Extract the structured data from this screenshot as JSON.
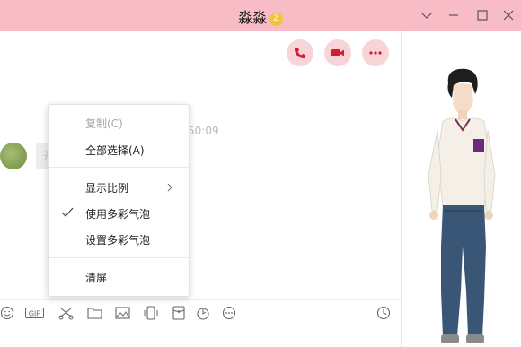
{
  "window": {
    "title": "淼淼",
    "vip_badge": "Z"
  },
  "chat": {
    "timestamp": ":50:09",
    "bubble_text": "开会开会了"
  },
  "menu": {
    "items": [
      {
        "label": "复制(C)",
        "enabled": false
      },
      {
        "label": "全部选择(A)",
        "enabled": true
      },
      {
        "label": "显示比例",
        "enabled": true,
        "submenu": true
      },
      {
        "label": "使用多彩气泡",
        "enabled": true,
        "checked": true
      },
      {
        "label": "设置多彩气泡",
        "enabled": true
      },
      {
        "label": "清屏",
        "enabled": true
      }
    ]
  },
  "toolbar": {
    "gif_label": "GIF",
    "icons": [
      "emoji-icon",
      "gif-icon",
      "scissors-icon",
      "folder-icon",
      "image-icon",
      "shake-icon",
      "red-packet-icon",
      "music-icon",
      "more-icon",
      "history-icon"
    ]
  },
  "header_actions": [
    "phone-icon",
    "video-icon",
    "more-icon"
  ],
  "colors": {
    "titlebar": "#f7bcc5",
    "accent_red": "#d8182d",
    "action_bg": "#f6d4d8"
  }
}
